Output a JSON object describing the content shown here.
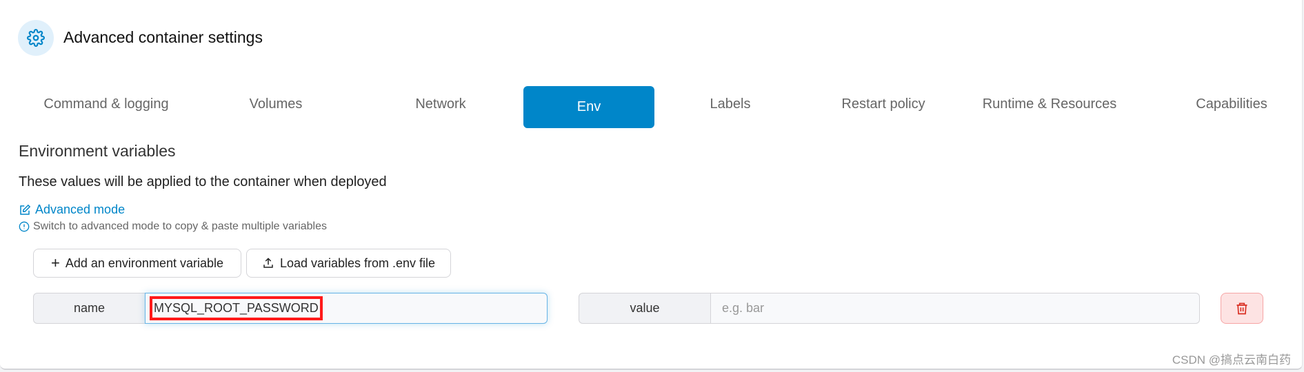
{
  "header": {
    "title": "Advanced container settings",
    "icon": "gear-icon"
  },
  "tabs": [
    {
      "label": "Command & logging",
      "active": false
    },
    {
      "label": "Volumes",
      "active": false
    },
    {
      "label": "Network",
      "active": false
    },
    {
      "label": "Env",
      "active": true
    },
    {
      "label": "Labels",
      "active": false
    },
    {
      "label": "Restart policy",
      "active": false
    },
    {
      "label": "Runtime & Resources",
      "active": false
    },
    {
      "label": "Capabilities",
      "active": false
    }
  ],
  "env": {
    "heading": "Environment variables",
    "description": "These values will be applied to the container when deployed",
    "advanced_mode_link": "Advanced mode",
    "hint": "Switch to advanced mode to copy & paste multiple variables",
    "add_button": "Add an environment variable",
    "load_button": "Load variables from .env file",
    "row": {
      "name_label": "name",
      "name_value": "MYSQL_ROOT_PASSWORD",
      "value_label": "value",
      "value_placeholder": "e.g. bar",
      "value_value": ""
    }
  },
  "watermark": "CSDN @搞点云南白药",
  "colors": {
    "accent": "#0086c9",
    "danger": "#d92d20",
    "highlight_box": "#ff1a1a"
  }
}
